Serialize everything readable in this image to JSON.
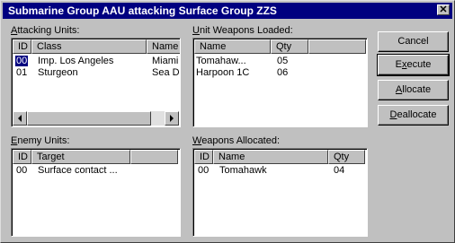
{
  "window": {
    "title": "Submarine Group AAU attacking Surface Group ZZS",
    "close_glyph": "✕"
  },
  "attacking": {
    "label_key": "A",
    "label_rest": "ttacking Units:",
    "headers": [
      "ID",
      "Class",
      "Name"
    ],
    "rows": [
      [
        "00",
        "Imp. Los Angeles",
        "Miami"
      ],
      [
        "01",
        "Sturgeon",
        "Sea D"
      ]
    ]
  },
  "loaded": {
    "label_key": "U",
    "label_rest": "nit Weapons Loaded:",
    "headers": [
      "Name",
      "Qty"
    ],
    "rows": [
      [
        "Tomahaw...",
        "05"
      ],
      [
        "Harpoon 1C",
        "06"
      ]
    ]
  },
  "enemy": {
    "label_key": "E",
    "label_rest": "nemy Units:",
    "headers": [
      "ID",
      "Target"
    ],
    "rows": [
      [
        "00",
        "Surface contact ..."
      ]
    ]
  },
  "allocated": {
    "label_key": "W",
    "label_rest": "eapons Allocated:",
    "headers": [
      "ID",
      "Name",
      "Qty"
    ],
    "rows": [
      [
        "00",
        "Tomahawk",
        "04"
      ]
    ]
  },
  "buttons": {
    "cancel": "Cancel",
    "execute_key": "x",
    "execute_pre": "E",
    "execute_post": "ecute",
    "allocate_key": "A",
    "allocate_rest": "llocate",
    "deallocate_key": "D",
    "deallocate_rest": "eallocate"
  }
}
